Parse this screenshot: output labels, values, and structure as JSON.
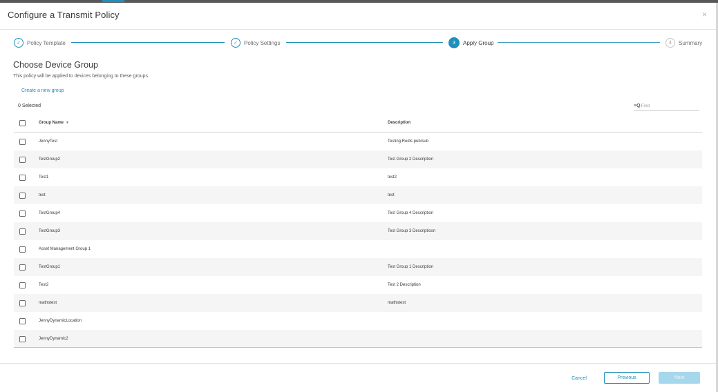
{
  "dialog": {
    "title": "Configure a Transmit Policy",
    "close_glyph": "×"
  },
  "wizard": {
    "steps": [
      {
        "label": "Policy Template",
        "state": "done",
        "marker": "✓"
      },
      {
        "label": "Policy Settings",
        "state": "done",
        "marker": "✓"
      },
      {
        "label": "Apply Group",
        "state": "active",
        "marker": "3"
      },
      {
        "label": "Summary",
        "state": "todo",
        "marker": "4"
      }
    ]
  },
  "main": {
    "heading": "Choose Device Group",
    "subheading": "This policy will be applied to devices belonging to these groups.",
    "create_link": "Create a new group",
    "selected_count": "0 Selected",
    "search": {
      "icons": "≡Q",
      "placeholder": "Find"
    }
  },
  "table": {
    "columns": {
      "name": "Group Name",
      "description": "Description",
      "sort_glyph": "▼"
    },
    "rows": [
      {
        "name": "JennyTest",
        "description": "Testing Redis pub/sub"
      },
      {
        "name": "TestGroup2",
        "description": "Test Group 2 Description"
      },
      {
        "name": "Test1",
        "description": "test2"
      },
      {
        "name": "test",
        "description": "test"
      },
      {
        "name": "TestGroup4",
        "description": "Test Group 4 Description"
      },
      {
        "name": "TestGroup3",
        "description": "Test Group 3 Descriptiosn"
      },
      {
        "name": "Asset Management Group 1",
        "description": ""
      },
      {
        "name": "TestGroup1",
        "description": "Test Group 1 Description"
      },
      {
        "name": "Test2",
        "description": "Test 2 Description"
      },
      {
        "name": "mathstest",
        "description": "mathstest"
      },
      {
        "name": "JennyDynamicLocation",
        "description": ""
      },
      {
        "name": "JennyDynamic2",
        "description": ""
      }
    ]
  },
  "footer": {
    "cancel": "Cancel",
    "previous": "Previous",
    "next": "Next"
  },
  "colors": {
    "accent": "#1e8ebb",
    "next_disabled": "#a6d8ed",
    "row_alt": "#f5f5f6"
  }
}
